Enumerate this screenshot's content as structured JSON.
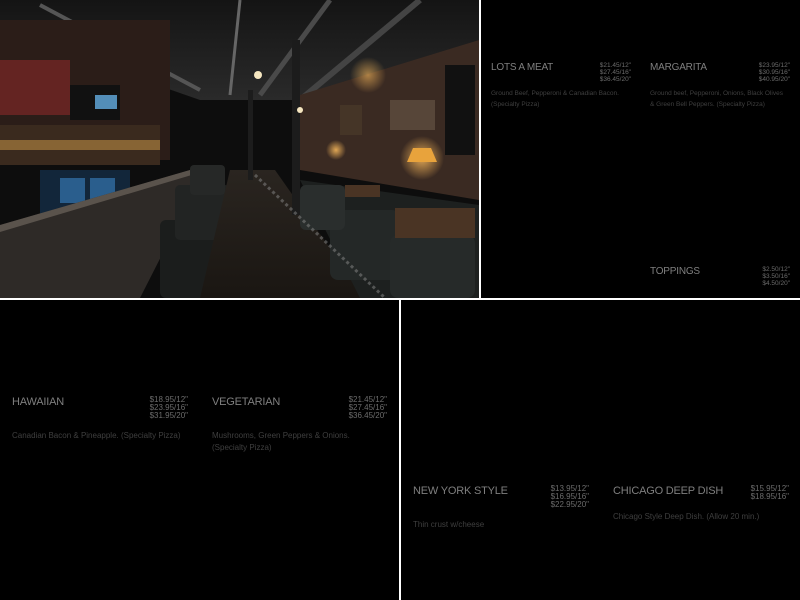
{
  "panels": {
    "top_right": {
      "items": [
        {
          "name": "LOTS A MEAT",
          "prices": [
            "$21.45/12\"",
            "$27.45/16\"",
            "$36.45/20\""
          ],
          "description": "Ground Beef, Pepperoni & Canadian Bacon. (Specialty Pizza)"
        },
        {
          "name": "MARGARITA",
          "prices": [
            "$23.95/12\"",
            "$30.95/16\"",
            "$40.95/20\""
          ],
          "description": "Ground beef, Pepperoni, Onions, Black Olives & Green Bell Peppers. (Specialty Pizza)"
        },
        {
          "name": "TOPPINGS",
          "prices": [
            "$2.50/12\"",
            "$3.50/16\"",
            "$4.50/20\""
          ],
          "description": ""
        }
      ]
    },
    "bottom_left": {
      "items": [
        {
          "name": "HAWAIIAN",
          "prices": [
            "$18.95/12\"",
            "$23.95/16\"",
            "$31.95/20\""
          ],
          "description": "Canadian Bacon & Pineapple. (Specialty Pizza)"
        },
        {
          "name": "VEGETARIAN",
          "prices": [
            "$21.45/12\"",
            "$27.45/16\"",
            "$36.45/20\""
          ],
          "description": "Mushrooms, Green Peppers & Onions. (Specialty Pizza)"
        }
      ]
    },
    "bottom_right": {
      "items": [
        {
          "name": "NEW YORK STYLE",
          "prices": [
            "$13.95/12\"",
            "$16.95/16\"",
            "$22.95/20\""
          ],
          "description": "Thin crust w/cheese"
        },
        {
          "name": "CHICAGO DEEP DISH",
          "prices": [
            "$15.95/12\"",
            "$18.95/16\""
          ],
          "description": "Chicago Style Deep Dish. (Allow 20 min.)"
        }
      ]
    }
  },
  "colors": {
    "panel_bg": "#000000",
    "divider": "#ffffff",
    "item_name": "#7f7f7f",
    "price": "#6c6c6c",
    "description": "#3f3f3f",
    "lamp_glow": "#e8a33c"
  }
}
